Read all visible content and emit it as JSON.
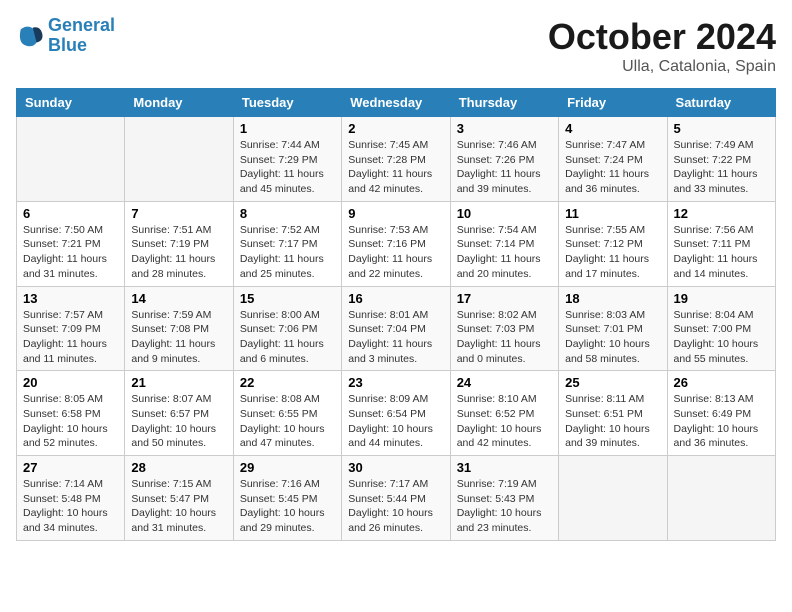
{
  "header": {
    "logo_line1": "General",
    "logo_line2": "Blue",
    "month": "October 2024",
    "location": "Ulla, Catalonia, Spain"
  },
  "days_of_week": [
    "Sunday",
    "Monday",
    "Tuesday",
    "Wednesday",
    "Thursday",
    "Friday",
    "Saturday"
  ],
  "weeks": [
    [
      {
        "day": "",
        "info": ""
      },
      {
        "day": "",
        "info": ""
      },
      {
        "day": "1",
        "info": "Sunrise: 7:44 AM\nSunset: 7:29 PM\nDaylight: 11 hours and 45 minutes."
      },
      {
        "day": "2",
        "info": "Sunrise: 7:45 AM\nSunset: 7:28 PM\nDaylight: 11 hours and 42 minutes."
      },
      {
        "day": "3",
        "info": "Sunrise: 7:46 AM\nSunset: 7:26 PM\nDaylight: 11 hours and 39 minutes."
      },
      {
        "day": "4",
        "info": "Sunrise: 7:47 AM\nSunset: 7:24 PM\nDaylight: 11 hours and 36 minutes."
      },
      {
        "day": "5",
        "info": "Sunrise: 7:49 AM\nSunset: 7:22 PM\nDaylight: 11 hours and 33 minutes."
      }
    ],
    [
      {
        "day": "6",
        "info": "Sunrise: 7:50 AM\nSunset: 7:21 PM\nDaylight: 11 hours and 31 minutes."
      },
      {
        "day": "7",
        "info": "Sunrise: 7:51 AM\nSunset: 7:19 PM\nDaylight: 11 hours and 28 minutes."
      },
      {
        "day": "8",
        "info": "Sunrise: 7:52 AM\nSunset: 7:17 PM\nDaylight: 11 hours and 25 minutes."
      },
      {
        "day": "9",
        "info": "Sunrise: 7:53 AM\nSunset: 7:16 PM\nDaylight: 11 hours and 22 minutes."
      },
      {
        "day": "10",
        "info": "Sunrise: 7:54 AM\nSunset: 7:14 PM\nDaylight: 11 hours and 20 minutes."
      },
      {
        "day": "11",
        "info": "Sunrise: 7:55 AM\nSunset: 7:12 PM\nDaylight: 11 hours and 17 minutes."
      },
      {
        "day": "12",
        "info": "Sunrise: 7:56 AM\nSunset: 7:11 PM\nDaylight: 11 hours and 14 minutes."
      }
    ],
    [
      {
        "day": "13",
        "info": "Sunrise: 7:57 AM\nSunset: 7:09 PM\nDaylight: 11 hours and 11 minutes."
      },
      {
        "day": "14",
        "info": "Sunrise: 7:59 AM\nSunset: 7:08 PM\nDaylight: 11 hours and 9 minutes."
      },
      {
        "day": "15",
        "info": "Sunrise: 8:00 AM\nSunset: 7:06 PM\nDaylight: 11 hours and 6 minutes."
      },
      {
        "day": "16",
        "info": "Sunrise: 8:01 AM\nSunset: 7:04 PM\nDaylight: 11 hours and 3 minutes."
      },
      {
        "day": "17",
        "info": "Sunrise: 8:02 AM\nSunset: 7:03 PM\nDaylight: 11 hours and 0 minutes."
      },
      {
        "day": "18",
        "info": "Sunrise: 8:03 AM\nSunset: 7:01 PM\nDaylight: 10 hours and 58 minutes."
      },
      {
        "day": "19",
        "info": "Sunrise: 8:04 AM\nSunset: 7:00 PM\nDaylight: 10 hours and 55 minutes."
      }
    ],
    [
      {
        "day": "20",
        "info": "Sunrise: 8:05 AM\nSunset: 6:58 PM\nDaylight: 10 hours and 52 minutes."
      },
      {
        "day": "21",
        "info": "Sunrise: 8:07 AM\nSunset: 6:57 PM\nDaylight: 10 hours and 50 minutes."
      },
      {
        "day": "22",
        "info": "Sunrise: 8:08 AM\nSunset: 6:55 PM\nDaylight: 10 hours and 47 minutes."
      },
      {
        "day": "23",
        "info": "Sunrise: 8:09 AM\nSunset: 6:54 PM\nDaylight: 10 hours and 44 minutes."
      },
      {
        "day": "24",
        "info": "Sunrise: 8:10 AM\nSunset: 6:52 PM\nDaylight: 10 hours and 42 minutes."
      },
      {
        "day": "25",
        "info": "Sunrise: 8:11 AM\nSunset: 6:51 PM\nDaylight: 10 hours and 39 minutes."
      },
      {
        "day": "26",
        "info": "Sunrise: 8:13 AM\nSunset: 6:49 PM\nDaylight: 10 hours and 36 minutes."
      }
    ],
    [
      {
        "day": "27",
        "info": "Sunrise: 7:14 AM\nSunset: 5:48 PM\nDaylight: 10 hours and 34 minutes."
      },
      {
        "day": "28",
        "info": "Sunrise: 7:15 AM\nSunset: 5:47 PM\nDaylight: 10 hours and 31 minutes."
      },
      {
        "day": "29",
        "info": "Sunrise: 7:16 AM\nSunset: 5:45 PM\nDaylight: 10 hours and 29 minutes."
      },
      {
        "day": "30",
        "info": "Sunrise: 7:17 AM\nSunset: 5:44 PM\nDaylight: 10 hours and 26 minutes."
      },
      {
        "day": "31",
        "info": "Sunrise: 7:19 AM\nSunset: 5:43 PM\nDaylight: 10 hours and 23 minutes."
      },
      {
        "day": "",
        "info": ""
      },
      {
        "day": "",
        "info": ""
      }
    ]
  ]
}
